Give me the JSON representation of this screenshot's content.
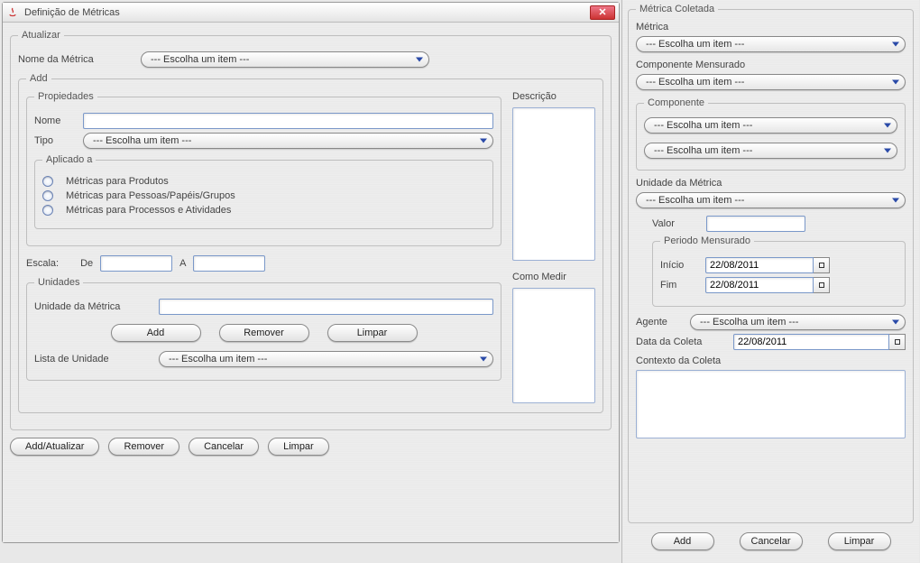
{
  "left": {
    "title": "Definição de Métricas",
    "atualizar": {
      "legend": "Atualizar",
      "nome_label": "Nome da Métrica",
      "nome_combo": "--- Escolha um item ---"
    },
    "add": {
      "legend": "Add",
      "propiedades": {
        "legend": "Propiedades",
        "nome_label": "Nome",
        "nome_value": "",
        "tipo_label": "Tipo",
        "tipo_combo": "--- Escolha um item ---",
        "descricao_label": "Descrição",
        "aplicado": {
          "legend": "Aplicado a",
          "opt1": "Métricas para Produtos",
          "opt2": "Métricas para Pessoas/Papéis/Grupos",
          "opt3": "Métricas para Processos e Atividades"
        }
      },
      "escala_label": "Escala:",
      "de_label": "De",
      "a_label": "A",
      "como_medir_label": "Como Medir",
      "unidades": {
        "legend": "Unidades",
        "unidade_label": "Unidade da Métrica",
        "add_btn": "Add",
        "remover_btn": "Remover",
        "limpar_btn": "Limpar",
        "lista_label": "Lista de Unidade",
        "lista_combo": "--- Escolha um item ---"
      }
    },
    "buttons": {
      "add_atualizar": "Add/Atualizar",
      "remover": "Remover",
      "cancelar": "Cancelar",
      "limpar": "Limpar"
    }
  },
  "right": {
    "legend": "Métrica Coletada",
    "metrica_label": "Métrica",
    "metrica_combo": "--- Escolha um item ---",
    "comp_mens_label": "Componente Mensurado",
    "comp_mens_combo": "--- Escolha um item ---",
    "componente": {
      "legend": "Componente",
      "combo1": "--- Escolha um item ---",
      "combo2": "--- Escolha um item ---"
    },
    "unidade_label": "Unidade da Métrica",
    "unidade_combo": "--- Escolha um item ---",
    "valor_label": "Valor",
    "valor_value": "",
    "periodo": {
      "legend": "Periodo Mensurado",
      "inicio_label": "Início",
      "inicio_value": "22/08/2011",
      "fim_label": "Fim",
      "fim_value": "22/08/2011"
    },
    "agente_label": "Agente",
    "agente_combo": "--- Escolha um item ---",
    "data_coleta_label": "Data da Coleta",
    "data_coleta_value": "22/08/2011",
    "contexto_label": "Contexto da Coleta",
    "buttons": {
      "add": "Add",
      "cancelar": "Cancelar",
      "limpar": "Limpar"
    }
  }
}
